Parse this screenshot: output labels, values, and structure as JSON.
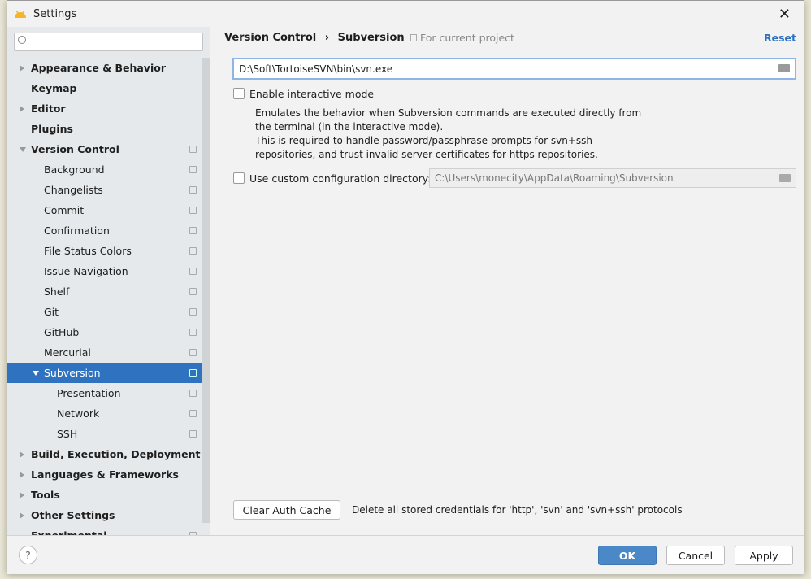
{
  "window": {
    "title": "Settings"
  },
  "sidebar": {
    "search_placeholder": "",
    "items": [
      {
        "label": "Appearance & Behavior",
        "level": 0,
        "bold": true,
        "arrow": "right"
      },
      {
        "label": "Keymap",
        "level": 0,
        "bold": true
      },
      {
        "label": "Editor",
        "level": 0,
        "bold": true,
        "arrow": "right"
      },
      {
        "label": "Plugins",
        "level": 0,
        "bold": true
      },
      {
        "label": "Version Control",
        "level": 0,
        "bold": true,
        "arrow": "down",
        "copy": true
      },
      {
        "label": "Background",
        "level": 1,
        "copy": true
      },
      {
        "label": "Changelists",
        "level": 1,
        "copy": true
      },
      {
        "label": "Commit",
        "level": 1,
        "copy": true
      },
      {
        "label": "Confirmation",
        "level": 1,
        "copy": true
      },
      {
        "label": "File Status Colors",
        "level": 1,
        "copy": true
      },
      {
        "label": "Issue Navigation",
        "level": 1,
        "copy": true
      },
      {
        "label": "Shelf",
        "level": 1,
        "copy": true
      },
      {
        "label": "Git",
        "level": 1,
        "copy": true
      },
      {
        "label": "GitHub",
        "level": 1,
        "copy": true
      },
      {
        "label": "Mercurial",
        "level": 1,
        "copy": true
      },
      {
        "label": "Subversion",
        "level": 1,
        "arrow": "down",
        "copy": true,
        "selected": true
      },
      {
        "label": "Presentation",
        "level": 2,
        "copy": true
      },
      {
        "label": "Network",
        "level": 2,
        "copy": true
      },
      {
        "label": "SSH",
        "level": 2,
        "copy": true
      },
      {
        "label": "Build, Execution, Deployment",
        "level": 0,
        "bold": true,
        "arrow": "right"
      },
      {
        "label": "Languages & Frameworks",
        "level": 0,
        "bold": true,
        "arrow": "right"
      },
      {
        "label": "Tools",
        "level": 0,
        "bold": true,
        "arrow": "right"
      },
      {
        "label": "Other Settings",
        "level": 0,
        "bold": true,
        "arrow": "right"
      },
      {
        "label": "Experimental",
        "level": 0,
        "bold": true,
        "copy": true
      }
    ]
  },
  "main": {
    "breadcrumb": [
      "Version Control",
      "Subversion"
    ],
    "breadcrumb_sep": "›",
    "scope": "For current project",
    "reset": "Reset",
    "svn_path": "D:\\Soft\\TortoiseSVN\\bin\\svn.exe",
    "interactive_label": "Enable interactive mode",
    "interactive_checked": false,
    "description": [
      "Emulates the behavior when Subversion commands are executed directly from",
      "the terminal (in the interactive mode).",
      "This is required to handle password/passphrase prompts for svn+ssh",
      "repositories, and trust invalid server certificates for https repositories."
    ],
    "custom_config_label": "Use custom configuration directory:",
    "custom_config_checked": false,
    "custom_config_path": "C:\\Users\\monecity\\AppData\\Roaming\\Subversion",
    "clear_cache": "Clear Auth Cache",
    "clear_cache_desc": "Delete all stored credentials for 'http', 'svn' and 'svn+ssh' protocols"
  },
  "footer": {
    "help": "?",
    "ok": "OK",
    "cancel": "Cancel",
    "apply": "Apply"
  },
  "colors": {
    "accent": "#2f72c0",
    "ok": "#4a88c8",
    "android_logo": "#f5b52a"
  }
}
